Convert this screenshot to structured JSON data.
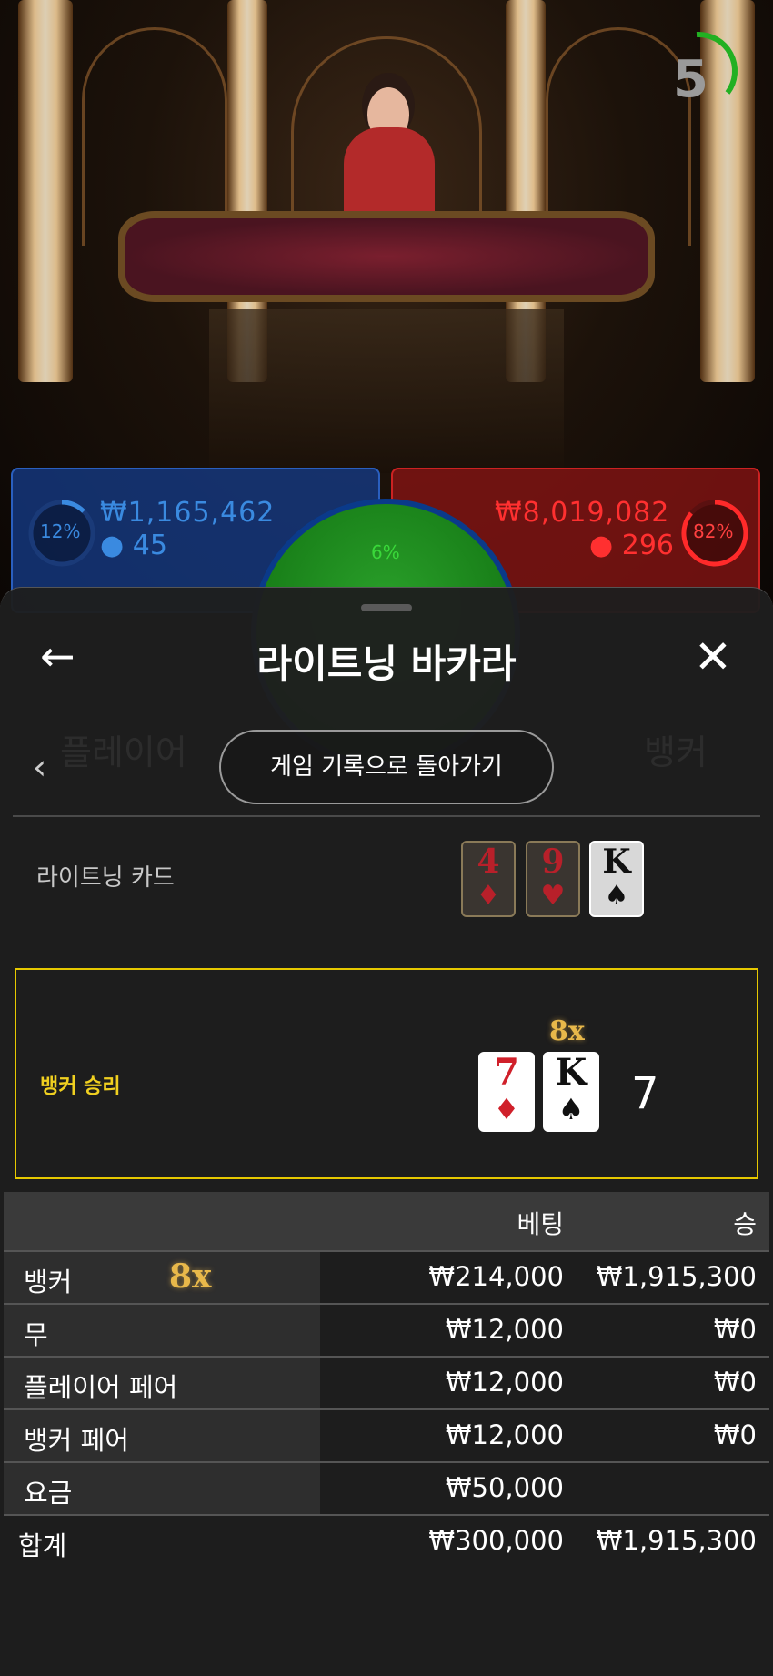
{
  "timer": {
    "value": "5"
  },
  "player_bet": {
    "percent": "12%",
    "amount": "₩1,165,462",
    "players": "45"
  },
  "banker_bet": {
    "percent": "82%",
    "amount": "₩8,019,082",
    "players": "296"
  },
  "tie_bet": {
    "percent": "6%"
  },
  "sheet": {
    "title": "라이트닝 바카라",
    "back_icon": "arrow-left-icon",
    "close_icon": "close-icon",
    "history_button": "게임 기록으로 돌아가기",
    "lightning_cards": {
      "label": "라이트닝 카드",
      "cards": [
        {
          "rank": "4",
          "suit": "♦",
          "color": "#b8202a",
          "highlighted": false
        },
        {
          "rank": "9",
          "suit": "♥",
          "color": "#b8202a",
          "highlighted": false
        },
        {
          "rank": "K",
          "suit": "♠",
          "color": "#111111",
          "highlighted": true
        }
      ]
    },
    "result": {
      "label": "뱅커 승리",
      "multiplier": "8x",
      "cards": [
        {
          "rank": "7",
          "suit": "♦",
          "color": "#d0202a"
        },
        {
          "rank": "K",
          "suit": "♠",
          "color": "#111111"
        }
      ],
      "total": "7"
    },
    "bets_table": {
      "headers": {
        "bet": "베팅",
        "win": "승"
      },
      "rows": [
        {
          "label": "뱅커",
          "multiplier": "8x",
          "bet": "₩214,000",
          "win": "₩1,915,300"
        },
        {
          "label": "무",
          "multiplier": "",
          "bet": "₩12,000",
          "win": "₩0"
        },
        {
          "label": "플레이어 페어",
          "multiplier": "",
          "bet": "₩12,000",
          "win": "₩0"
        },
        {
          "label": "뱅커 페어",
          "multiplier": "",
          "bet": "₩12,000",
          "win": "₩0"
        },
        {
          "label": "요금",
          "multiplier": "",
          "bet": "₩50,000",
          "win": ""
        }
      ],
      "total": {
        "label": "합계",
        "bet": "₩300,000",
        "win": "₩1,915,300"
      }
    }
  },
  "colors": {
    "accent_gold": "#e6c800",
    "player_blue": "#2a5fbf",
    "banker_red": "#cc2222",
    "tie_green": "#2aa02a"
  }
}
